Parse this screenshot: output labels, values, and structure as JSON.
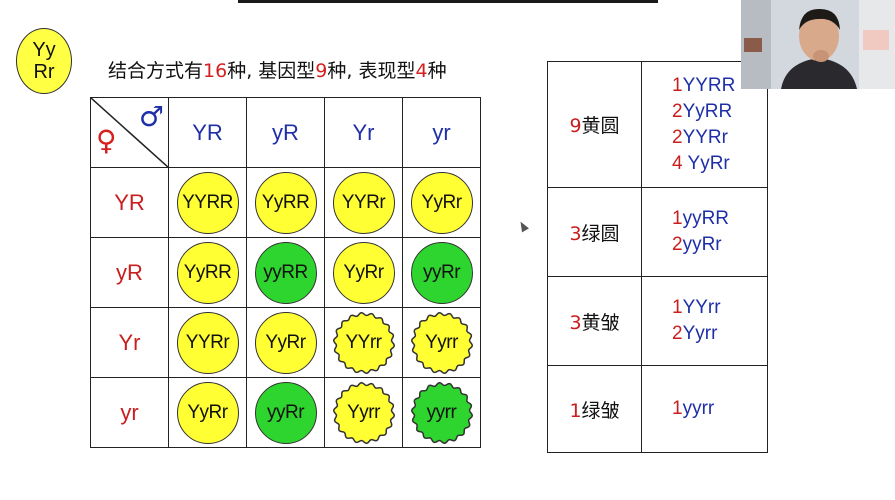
{
  "parent_genotype": {
    "line1": "Yy",
    "line2": "Rr"
  },
  "title": {
    "p1": "结合方式有",
    "n1": "16",
    "p2": "种, 基因型",
    "n2": "9",
    "p3": "种, 表现型",
    "n3": "4",
    "p4": "种"
  },
  "punnett": {
    "female_symbol": "♀",
    "male_symbol": "♂",
    "col_headers": [
      "YR",
      "yR",
      "Yr",
      "yr"
    ],
    "row_headers": [
      "YR",
      "yR",
      "Yr",
      "yr"
    ],
    "cells": [
      [
        {
          "g": "YYRR",
          "c": "yellow",
          "s": "round"
        },
        {
          "g": "YyRR",
          "c": "yellow",
          "s": "round"
        },
        {
          "g": "YYRr",
          "c": "yellow",
          "s": "round"
        },
        {
          "g": "YyRr",
          "c": "yellow",
          "s": "round"
        }
      ],
      [
        {
          "g": "YyRR",
          "c": "yellow",
          "s": "round"
        },
        {
          "g": "yyRR",
          "c": "green",
          "s": "round"
        },
        {
          "g": "YyRr",
          "c": "yellow",
          "s": "round"
        },
        {
          "g": "yyRr",
          "c": "green",
          "s": "round"
        }
      ],
      [
        {
          "g": "YYRr",
          "c": "yellow",
          "s": "round"
        },
        {
          "g": "YyRr",
          "c": "yellow",
          "s": "round"
        },
        {
          "g": "YYrr",
          "c": "yellow",
          "s": "wrinkled"
        },
        {
          "g": "Yyrr",
          "c": "yellow",
          "s": "wrinkled"
        }
      ],
      [
        {
          "g": "YyRr",
          "c": "yellow",
          "s": "round"
        },
        {
          "g": "yyRr",
          "c": "green",
          "s": "round"
        },
        {
          "g": "Yyrr",
          "c": "yellow",
          "s": "wrinkled"
        },
        {
          "g": "yyrr",
          "c": "green",
          "s": "wrinkled"
        }
      ]
    ]
  },
  "summary": [
    {
      "count": "9",
      "phenotype": "黄圆",
      "genotypes": [
        {
          "n": "1",
          "g": "YYRR"
        },
        {
          "n": "2",
          "g": "YyRR"
        },
        {
          "n": "2",
          "g": "YYRr"
        },
        {
          "n": "4 ",
          "g": "YyRr"
        }
      ]
    },
    {
      "count": "3",
      "phenotype": "绿圆",
      "genotypes": [
        {
          "n": "1",
          "g": "yyRR"
        },
        {
          "n": "2",
          "g": "yyRr"
        }
      ]
    },
    {
      "count": "3",
      "phenotype": "黄皱",
      "genotypes": [
        {
          "n": "1",
          "g": "YYrr"
        },
        {
          "n": "2",
          "g": "Yyrr"
        }
      ]
    },
    {
      "count": "1",
      "phenotype": "绿皱",
      "genotypes": [
        {
          "n": "1",
          "g": "yyrr"
        }
      ]
    }
  ],
  "colors": {
    "yellow": "#ffff33",
    "green": "#2ed52e",
    "red": "#c81e1e",
    "blue": "#1f2fa8"
  }
}
